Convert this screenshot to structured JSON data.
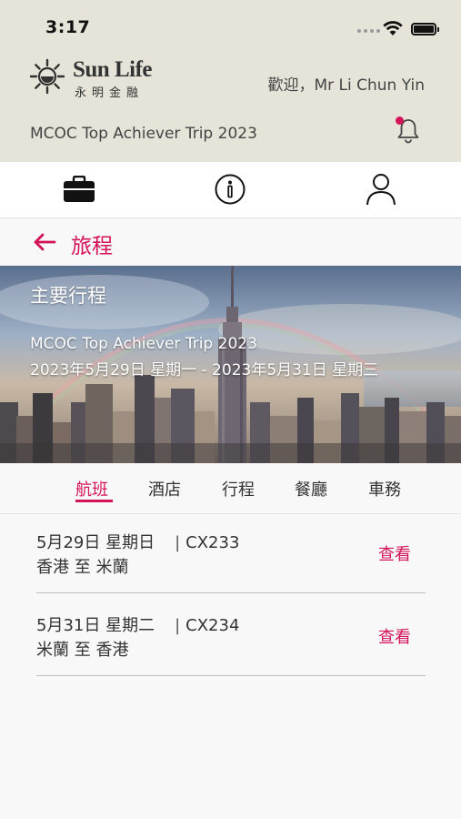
{
  "status_bar": {
    "time": "3:17"
  },
  "header": {
    "logo_en": "Sun Life",
    "logo_zh": "永明金融",
    "welcome": "歡迎，Mr Li Chun Yin",
    "trip_title": "MCOC Top Achiever Trip 2023",
    "notification_dot_color": "#d4145a"
  },
  "nav": {
    "items": [
      {
        "icon": "briefcase-icon"
      },
      {
        "icon": "info-icon"
      },
      {
        "icon": "user-icon"
      }
    ]
  },
  "page": {
    "title": "旅程"
  },
  "hero": {
    "heading": "主要行程",
    "trip_name": "MCOC Top Achiever Trip 2023",
    "dates": "2023年5月29日 星期一 - 2023年5月31日 星期三"
  },
  "tabs": [
    {
      "label": "航班",
      "active": true
    },
    {
      "label": "酒店",
      "active": false
    },
    {
      "label": "行程",
      "active": false
    },
    {
      "label": "餐廳",
      "active": false
    },
    {
      "label": "車務",
      "active": false
    }
  ],
  "flights": [
    {
      "date": "5月29日 星期日",
      "flight_no": "CX233",
      "route": "香港 至 米蘭",
      "action": "查看"
    },
    {
      "date": "5月31日 星期二",
      "flight_no": "CX234",
      "route": "米蘭 至 香港",
      "action": "查看"
    }
  ],
  "colors": {
    "accent": "#d4145a",
    "header_bg": "#e6e3d9"
  }
}
